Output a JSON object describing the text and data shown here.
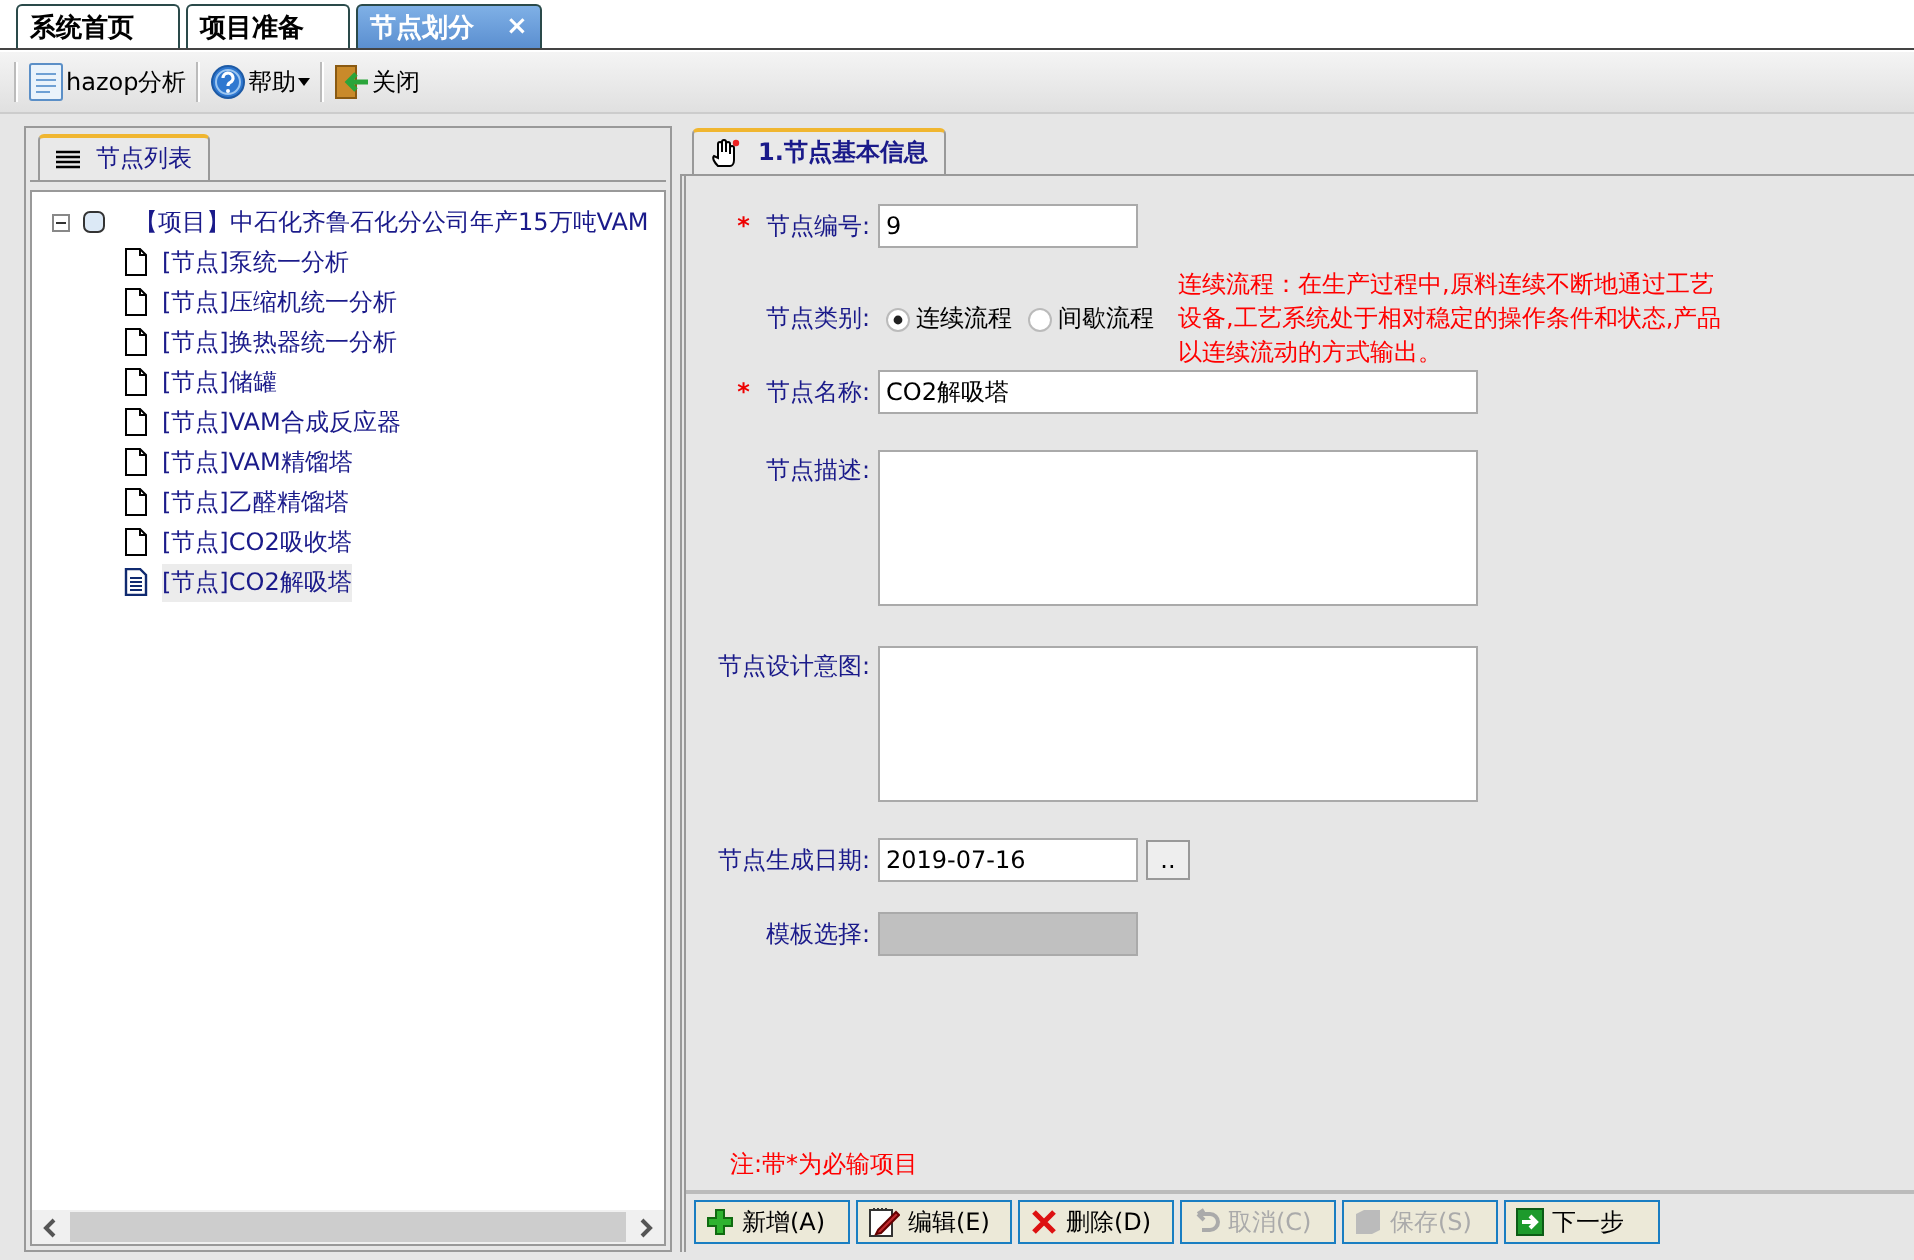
{
  "tabs": [
    {
      "label": "系统首页",
      "selected": false,
      "closable": false
    },
    {
      "label": "项目准备",
      "selected": false,
      "closable": false
    },
    {
      "label": "节点划分",
      "selected": true,
      "closable": true
    }
  ],
  "close_tab_glyph": "×",
  "toolbar": [
    {
      "kind": "doc",
      "label": "hazop分析",
      "dropdown": false
    },
    {
      "kind": "help",
      "label": "帮助",
      "dropdown": true
    },
    {
      "kind": "exit",
      "label": "关闭",
      "dropdown": false
    }
  ],
  "left_panel": {
    "title": "节点列表",
    "tree": {
      "label": "【项目】中石化齐鲁石化分公司年产15万吨VAM",
      "expanded": true,
      "children": [
        {
          "label": "[节点]泵统一分析",
          "selected": false
        },
        {
          "label": "[节点]压缩机统一分析",
          "selected": false
        },
        {
          "label": "[节点]换热器统一分析",
          "selected": false
        },
        {
          "label": "[节点]储罐",
          "selected": false
        },
        {
          "label": "[节点]VAM合成反应器",
          "selected": false
        },
        {
          "label": "[节点]VAM精馏塔",
          "selected": false
        },
        {
          "label": "[节点]乙醛精馏塔",
          "selected": false
        },
        {
          "label": "[节点]CO2吸收塔",
          "selected": false
        },
        {
          "label": "[节点]CO2解吸塔",
          "selected": true
        }
      ]
    }
  },
  "right_panel": {
    "title": "1.节点基本信息",
    "form": {
      "required_mark": "*",
      "node_number": {
        "label": "节点编号:",
        "value": "9",
        "required": true
      },
      "node_type": {
        "label": "节点类别:",
        "options": [
          {
            "label": "连续流程",
            "selected": true
          },
          {
            "label": "间歇流程",
            "selected": false
          }
        ],
        "hint": "连续流程：在生产过程中,原料连续不断地通过工艺设备,工艺系统处于相对稳定的操作条件和状态,产品以连续流动的方式输出。"
      },
      "node_name": {
        "label": "节点名称:",
        "value": "CO2解吸塔",
        "required": true
      },
      "description": {
        "label": "节点描述:"
      },
      "design_intent": {
        "label": "节点设计意图:"
      },
      "date": {
        "label": "节点生成日期:",
        "value": "2019-07-16",
        "button": ".."
      },
      "template": {
        "label": "模板选择:",
        "disabled": true
      }
    },
    "note": "注:带*为必输项目",
    "buttons": [
      {
        "kind": "add",
        "label": "新增(A)",
        "disabled": false
      },
      {
        "kind": "edit",
        "label": "编辑(E)",
        "disabled": false
      },
      {
        "kind": "delete",
        "label": "删除(D)",
        "disabled": false
      },
      {
        "kind": "cancel",
        "label": "取消(C)",
        "disabled": true
      },
      {
        "kind": "save",
        "label": "保存(S)",
        "disabled": true
      },
      {
        "kind": "next",
        "label": "下一步",
        "disabled": false
      }
    ]
  }
}
